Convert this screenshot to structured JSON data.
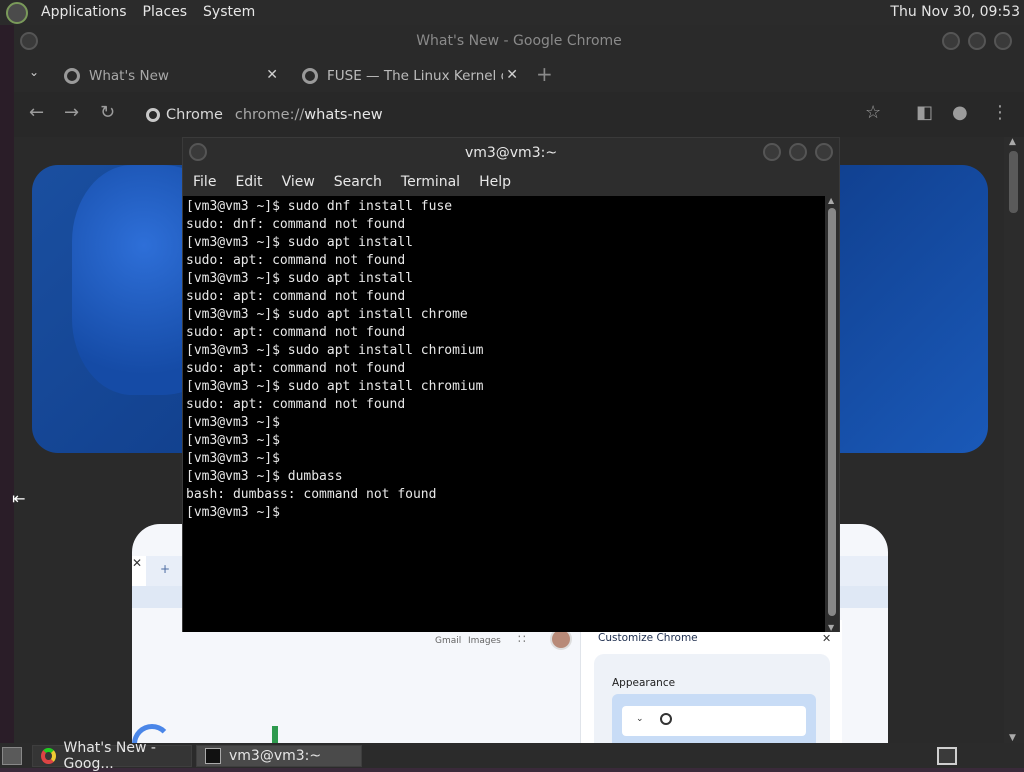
{
  "top_panel": {
    "menus": [
      "Applications",
      "Places",
      "System"
    ],
    "clock": "Thu Nov 30, 09:53"
  },
  "chrome": {
    "window_title": "What's New - Google Chrome",
    "tabs": [
      {
        "label": "What's New",
        "icon": "chrome-icon"
      },
      {
        "label": "FUSE — The Linux Kernel do",
        "icon": "globe-icon"
      }
    ],
    "omnibox": {
      "chip_label": "Chrome",
      "url_scheme": "chrome://",
      "url_host": "whats-new"
    },
    "page": {
      "gmail": "Gmail",
      "images": "Images",
      "customize_chrome": "Customize Chrome",
      "appearance": "Appearance"
    }
  },
  "terminal": {
    "title": "vm3@vm3:~",
    "menu": [
      "File",
      "Edit",
      "View",
      "Search",
      "Terminal",
      "Help"
    ],
    "lines": [
      "[vm3@vm3 ~]$ sudo dnf install fuse",
      "sudo: dnf: command not found",
      "[vm3@vm3 ~]$ sudo apt install",
      "sudo: apt: command not found",
      "[vm3@vm3 ~]$ sudo apt install",
      "sudo: apt: command not found",
      "[vm3@vm3 ~]$ sudo apt install chrome",
      "sudo: apt: command not found",
      "[vm3@vm3 ~]$ sudo apt install chromium",
      "sudo: apt: command not found",
      "[vm3@vm3 ~]$ sudo apt install chromium",
      "sudo: apt: command not found",
      "[vm3@vm3 ~]$",
      "[vm3@vm3 ~]$",
      "[vm3@vm3 ~]$",
      "[vm3@vm3 ~]$ dumbass",
      "bash: dumbass: command not found",
      "[vm3@vm3 ~]$"
    ]
  },
  "taskbar": {
    "tasks": [
      {
        "label": "What's New - Goog...",
        "icon": "chrome-icon"
      },
      {
        "label": "vm3@vm3:~",
        "icon": "terminal-icon"
      }
    ]
  }
}
